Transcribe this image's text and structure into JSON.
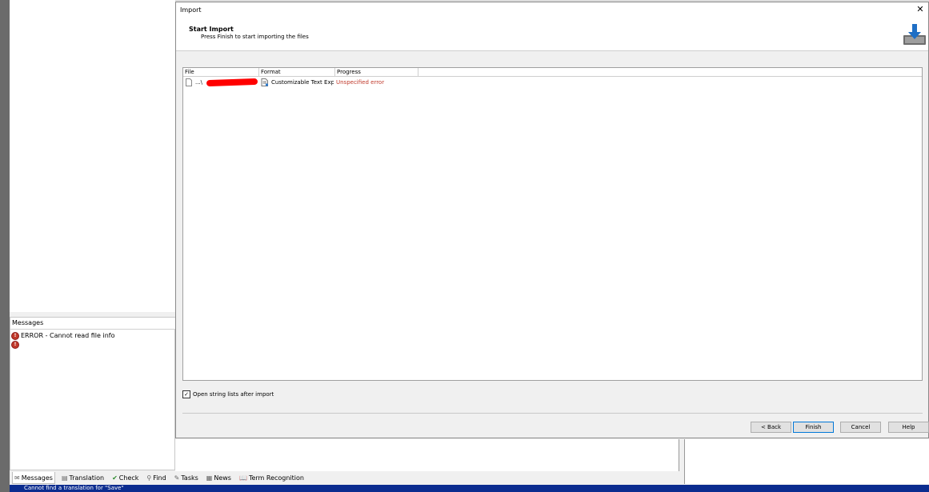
{
  "dialog": {
    "title": "Import",
    "close": "✕",
    "header_title": "Start Import",
    "header_subtitle": "Press Finish to start importing the files",
    "icon": "import-download-icon",
    "columns": [
      "File",
      "Format",
      "Progress"
    ],
    "rows": [
      {
        "file": "...\\",
        "format": "Customizable Text Exp",
        "progress": "Unspecified error"
      }
    ],
    "checkbox_label": "Open string lists after import",
    "checkbox_checked": true,
    "buttons": {
      "back": "< Back",
      "finish": "Finish",
      "cancel": "Cancel",
      "help": "Help"
    }
  },
  "messages": {
    "header": "Messages",
    "items": [
      "ERROR - Cannot read file info",
      ""
    ]
  },
  "bottom_tabs": [
    "Messages",
    "Translation",
    "Check",
    "Find",
    "Tasks",
    "News",
    "Term Recognition"
  ],
  "status_text": "Cannot find a translation for \"Save\"",
  "colors": {
    "error": "#c0392b",
    "status_bar": "#0b2c8f",
    "accent": "#0078d7"
  }
}
